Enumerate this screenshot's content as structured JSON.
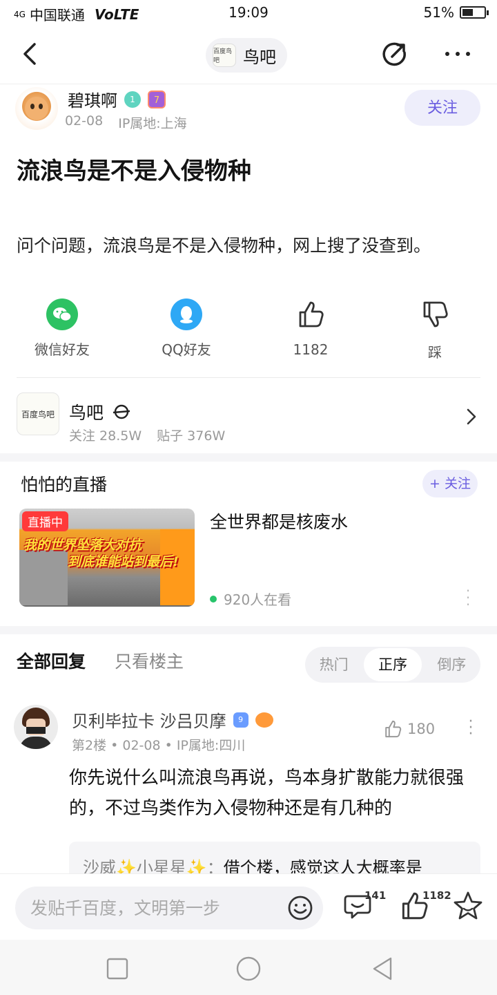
{
  "status_bar": {
    "signal_tag": "4G",
    "carrier": "中国联通",
    "volte": "VoLTE",
    "time": "19:09",
    "battery_text": "51%",
    "battery_level": 0.51
  },
  "nav": {
    "forum_name": "鸟吧",
    "forum_logo_text": "百度鸟吧"
  },
  "author": {
    "name": "碧琪啊",
    "level": "1",
    "badge": "7",
    "date": "02-08",
    "ip": "IP属地:上海",
    "follow_label": "关注"
  },
  "post": {
    "title": "流浪鸟是不是入侵物种",
    "body": "问个问题，流浪鸟是不是入侵物种，网上搜了没查到。"
  },
  "actions": {
    "wechat": "微信好友",
    "qq": "QQ好友",
    "likes": "1182",
    "dislike": "踩"
  },
  "forum_card": {
    "name": "鸟吧",
    "logo_text": "百度鸟吧",
    "followers": "关注 28.5W",
    "posts": "贴子 376W"
  },
  "live": {
    "section_title": "怕怕的直播",
    "follow_label": "+ 关注",
    "tag": "直播中",
    "caption_line1": "我的世界坠落大对抗",
    "caption_line2": "到底谁能站到最后!",
    "title": "全世界都是核废水",
    "viewers": "920人在看"
  },
  "replies": {
    "tab_all": "全部回复",
    "tab_op": "只看楼主",
    "sort_hot": "热门",
    "sort_asc": "正序",
    "sort_desc": "倒序"
  },
  "comment": {
    "name": "贝利毕拉卡 沙吕贝摩",
    "level": "9",
    "meta": "第2楼 • 02-08 • IP属地:四川",
    "likes": "180",
    "text": "你先说什么叫流浪鸟再说，鸟本身扩散能力就很强的，不过鸟类作为入侵物种还是有几种的",
    "sub_author": "沙威✨小星星✨：",
    "sub_text": "借个楼，感觉这人大概率是"
  },
  "bottom_bar": {
    "input_placeholder": "发贴千百度，文明第一步",
    "comment_count": "141",
    "like_count": "1182"
  }
}
